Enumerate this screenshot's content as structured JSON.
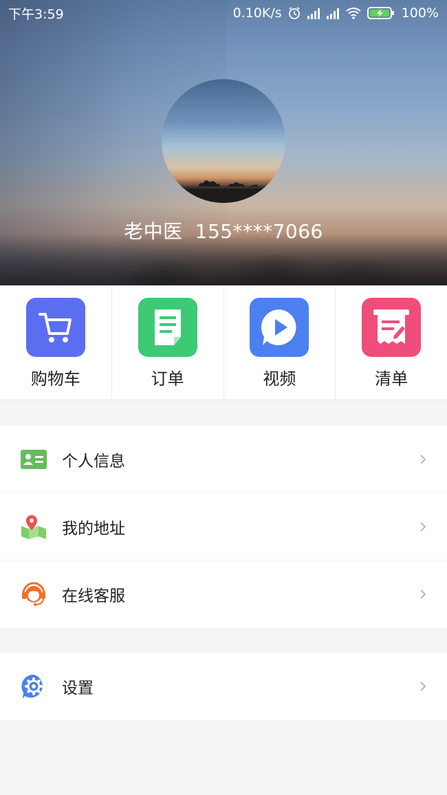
{
  "status_bar": {
    "time": "下午3:59",
    "net_speed": "0.10K/s",
    "battery": "100%",
    "icons": [
      "alarm-icon",
      "signal-icon",
      "signal-icon",
      "wifi-icon",
      "battery-charging-icon"
    ]
  },
  "profile": {
    "name": "老中医",
    "phone": "155****7066"
  },
  "shortcuts": [
    {
      "label": "购物车",
      "icon": "cart-icon",
      "color": "#5b6ef0"
    },
    {
      "label": "订单",
      "icon": "order-doc-icon",
      "color": "#3ec975"
    },
    {
      "label": "视频",
      "icon": "video-play-icon",
      "color": "#4c7ff0"
    },
    {
      "label": "清单",
      "icon": "list-receipt-icon",
      "color": "#ef4d7b"
    }
  ],
  "menu": [
    {
      "label": "个人信息",
      "icon": "id-card-icon"
    },
    {
      "label": "我的地址",
      "icon": "map-pin-icon"
    },
    {
      "label": "在线客服",
      "icon": "customer-service-icon"
    }
  ],
  "settings": {
    "label": "设置",
    "icon": "gear-icon"
  },
  "colors": {
    "background": "#f5f5f5",
    "card": "#ffffff",
    "chevron": "#b8b8b8"
  }
}
